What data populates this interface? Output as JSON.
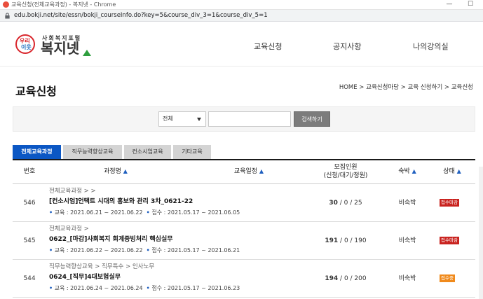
{
  "window": {
    "title": "교육신청(전체교육과정) - 복지넷 - Chrome",
    "minimize_label": "—",
    "maximize_label": "☐"
  },
  "address": {
    "url": "edu.bokji.net/site/essn/bokji_courseInfo.do?key=5&course_div_3=1&course_div_5=1"
  },
  "logo": {
    "circle_top": "우리",
    "circle_bottom": "이웃",
    "small_text": "사회복지포털",
    "big_text": "복지넷"
  },
  "nav": {
    "items": [
      "교육신청",
      "공지사항",
      "나의강의실"
    ]
  },
  "page": {
    "title": "교육신청",
    "breadcrumb": "HOME > 교육신청마당 > 교육 신청하기 > 교육신청"
  },
  "search": {
    "select_value": "전체",
    "input_value": "",
    "button_label": "검색하기"
  },
  "tabs": [
    "전체교육과정",
    "직무능력향상교육",
    "컨소시엄교육",
    "기타교육"
  ],
  "table": {
    "headers": {
      "num": "번호",
      "course": "과정명",
      "schedule": "교육일정",
      "recruit_1": "모집인원",
      "recruit_2": "(신청/대기/정원)",
      "lodging": "숙박",
      "status": "상태",
      "sort_symbol": "▲"
    },
    "rows": [
      {
        "num": "546",
        "category": "전체교육과정 > >",
        "name": "[컨소시엄]언택트 시대의 홍보와 관리 3차_0621-22",
        "edu": "교육 : 2021.06.21 ~ 2021.06.22",
        "reg": "접수 : 2021.05.17 ~ 2021.06.05",
        "applied": "30",
        "recruit_rest": " / 0 / 25",
        "lodging": "비숙박",
        "status": "접수마감",
        "status_color": "#c9231f"
      },
      {
        "num": "545",
        "category": "전체교육과정 >",
        "name": "0622_[마감]사회복지 회계증빙처리 핵심실무",
        "edu": "교육 : 2021.06.22 ~ 2021.06.22",
        "reg": "접수 : 2021.05.17 ~ 2021.06.21",
        "applied": "191",
        "recruit_rest": " / 0 / 190",
        "lodging": "비숙박",
        "status": "접수마감",
        "status_color": "#c9231f"
      },
      {
        "num": "544",
        "category": "직무능력향상교육 > 직무특수 > 인사노무",
        "name": "0624_[직무]4대보험실무",
        "edu": "교육 : 2021.06.24 ~ 2021.06.24",
        "reg": "접수 : 2021.05.17 ~ 2021.06.23",
        "applied": "194",
        "recruit_rest": " / 0 / 200",
        "lodging": "비숙박",
        "status": "접수중",
        "status_color": "#f08a1c"
      }
    ]
  },
  "colors": {
    "accent": "#0b57c4",
    "closed": "#c9231f",
    "open": "#f08a1c"
  }
}
